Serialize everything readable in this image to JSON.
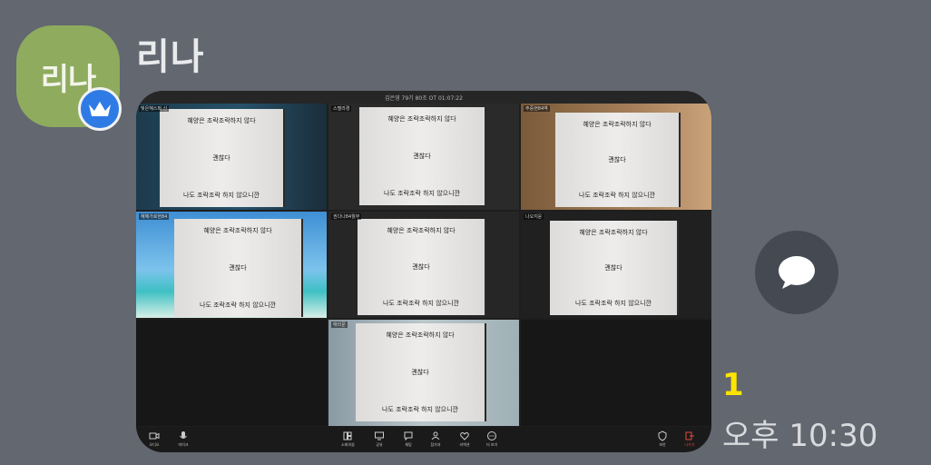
{
  "sender": {
    "avatar_text": "리나",
    "name": "리나",
    "badge_icon": "crown-icon"
  },
  "meeting": {
    "title": "김은영 79기 80조 OT 01:07:22",
    "sheet_lines": [
      "혜양은 조락조락하지 않다",
      "괜찮다",
      "나도 조락조락 하지 않으니깐"
    ],
    "participants": [
      {
        "label": "빛은혜스퍼 신"
      },
      {
        "label": "스텔라경"
      },
      {
        "label": "주중현84역"
      },
      {
        "label": "혜혜가로현84"
      },
      {
        "label": "권다나84월부"
      },
      {
        "label": "나오지윤"
      },
      {
        "label": "애리문"
      }
    ],
    "toolbar": {
      "left": [
        "오디오",
        "마이크"
      ],
      "center": [
        "소회의실",
        "공유",
        "채팅",
        "참가자",
        "리액션",
        "더 보기"
      ],
      "right": [
        "보안",
        "나가기"
      ]
    }
  },
  "unread_count": "1",
  "time": "오후 10:30",
  "colors": {
    "background": "#626770",
    "unread": "#ffe400",
    "avatar": "#8fab5e",
    "badge": "#2f7be6"
  }
}
